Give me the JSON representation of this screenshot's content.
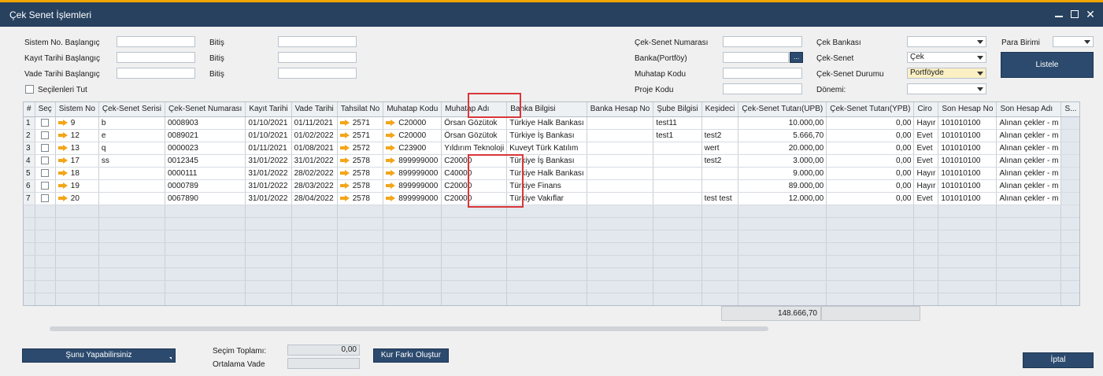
{
  "window": {
    "title": "Çek Senet İşlemleri"
  },
  "filters": {
    "sistem_no": "Sistem No. Başlangıç",
    "kayit_tarihi": "Kayıt Tarihi Başlangıç",
    "vade_tarihi": "Vade Tarihi Başlangıç",
    "bitis": "Bitiş",
    "secilenleri_tut": "Seçilenleri Tut",
    "cek_senet_numarasi": "Çek-Senet Numarası",
    "banka_portfoy": "Banka(Portföy)",
    "muhatap_kodu": "Muhatap Kodu",
    "proje_kodu": "Proje Kodu",
    "cek_bankasi": "Çek Bankası",
    "cek_senet": "Çek-Senet",
    "cek_senet_value": "Çek",
    "cek_senet_durumu": "Çek-Senet Durumu",
    "durum_value": "Portföyde",
    "donem": "Dönemi:",
    "para_birimi": "Para Birimi",
    "lookup_label": "...",
    "listele": "Listele"
  },
  "grid": {
    "columns": [
      "#",
      "Seç",
      "Sistem No",
      "Çek-Senet Serisi",
      "Çek-Senet Numarası",
      "Kayıt Tarihi",
      "Vade Tarihi",
      "Tahsilat No",
      "Muhatap Kodu",
      "Muhatap Adı",
      "Banka Bilgisi",
      "Banka Hesap No",
      "Şube Bilgisi",
      "Keşideci",
      "Çek-Senet Tutarı(UPB)",
      "Çek-Senet Tutarı(YPB)",
      "Ciro",
      "Son Hesap No",
      "Son Hesap Adı",
      "S..."
    ],
    "rows": [
      [
        "1",
        "9",
        "b",
        "0008903",
        "01/10/2021",
        "01/11/2021",
        "2571",
        "C20000",
        "Örsan Gözütok",
        "Türkiye Halk Bankası",
        "",
        "test11",
        "",
        "10.000,00",
        "0,00",
        "Hayır",
        "101010100",
        "Alınan çekler - m"
      ],
      [
        "2",
        "12",
        "e",
        "0089021",
        "01/10/2021",
        "01/02/2022",
        "2571",
        "C20000",
        "Örsan Gözütok",
        "Türkiye İş Bankası",
        "",
        "test1",
        "test2",
        "5.666,70",
        "0,00",
        "Evet",
        "101010100",
        "Alınan çekler - m"
      ],
      [
        "3",
        "13",
        "q",
        "0000023",
        "01/11/2021",
        "01/08/2021",
        "2572",
        "C23900",
        "Yıldırım Teknoloji",
        "Kuveyt Türk Katılım",
        "",
        "",
        "wert",
        "20.000,00",
        "0,00",
        "Evet",
        "101010100",
        "Alınan çekler - m"
      ],
      [
        "4",
        "17",
        "ss",
        "0012345",
        "31/01/2022",
        "31/01/2022",
        "2578",
        "899999000",
        "C20000",
        "Türkiye İş Bankası",
        "",
        "",
        "test2",
        "3.000,00",
        "0,00",
        "Evet",
        "101010100",
        "Alınan çekler - m"
      ],
      [
        "5",
        "18",
        "",
        "0000111",
        "31/01/2022",
        "28/02/2022",
        "2578",
        "899999000",
        "C40000",
        "Türkiye Halk Bankası",
        "",
        "",
        "",
        "9.000,00",
        "0,00",
        "Hayır",
        "101010100",
        "Alınan çekler - m"
      ],
      [
        "6",
        "19",
        "",
        "0000789",
        "31/01/2022",
        "28/03/2022",
        "2578",
        "899999000",
        "C20000",
        "Türkiye Finans",
        "",
        "",
        "",
        "89.000,00",
        "0,00",
        "Hayır",
        "101010100",
        "Alınan çekler - m"
      ],
      [
        "7",
        "20",
        "",
        "0067890",
        "31/01/2022",
        "28/04/2022",
        "2578",
        "899999000",
        "C20000",
        "Türkiye Vakıflar",
        "",
        "",
        "test test",
        "12.000,00",
        "0,00",
        "Evet",
        "101010100",
        "Alınan çekler - m"
      ]
    ],
    "total_upb": "148.666,70"
  },
  "footer": {
    "sunu_yapabilirsiniz": "Şunu Yapabilirsiniz",
    "secim_toplami": "Seçim Toplamı:",
    "secim_toplami_value": "0,00",
    "ortalama_vade": "Ortalama Vade",
    "kur_farki": "Kur Farkı Oluştur",
    "iptal": "İptal"
  }
}
